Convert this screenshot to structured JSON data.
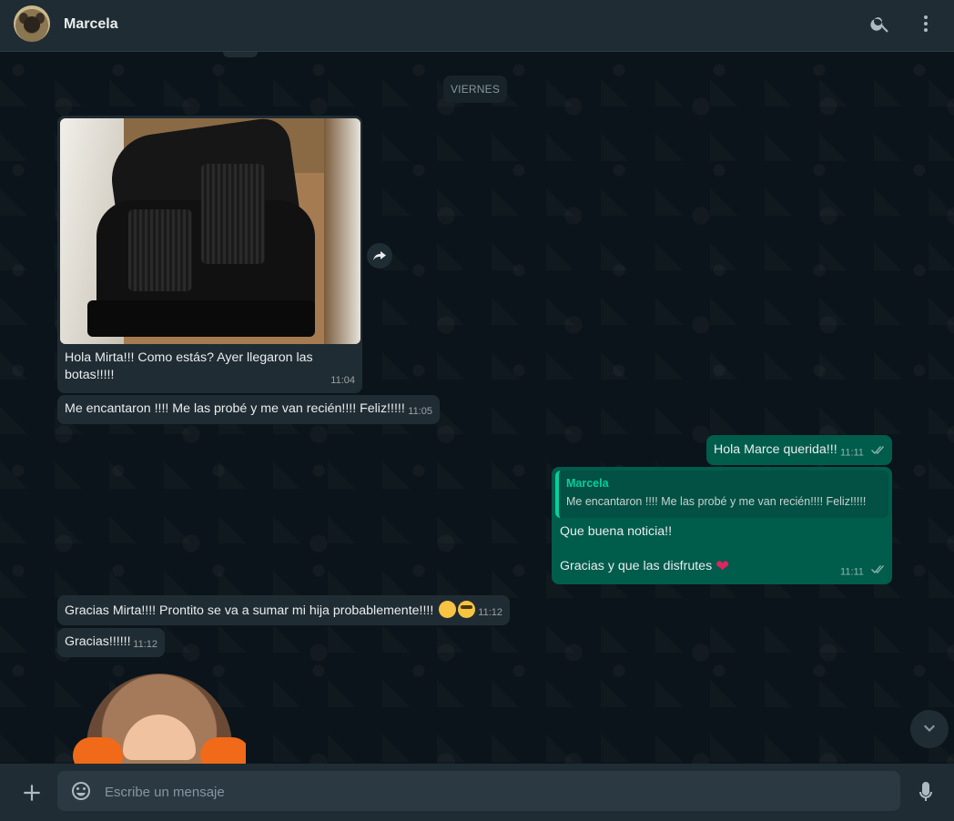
{
  "header": {
    "contact_name": "Marcela",
    "search_icon": "search-icon",
    "menu_icon": "more-vertical-icon"
  },
  "chat": {
    "day_label": "VIERNES",
    "messages": [
      {
        "type": "image",
        "direction": "in",
        "caption": "Hola Mirta!!! Como estás? Ayer llegaron las botas!!!!!",
        "time": "11:04"
      },
      {
        "type": "text",
        "direction": "in",
        "text": "Me encantaron !!!! Me las probé y me van recién!!!! Feliz!!!!!",
        "time": "11:05"
      },
      {
        "type": "text",
        "direction": "out",
        "text": "Hola Marce querida!!!",
        "time": "11:11",
        "status": "read"
      },
      {
        "type": "reply",
        "direction": "out",
        "quote_author": "Marcela",
        "quote_text": "Me encantaron !!!! Me las probé y me van recién!!!! Feliz!!!!!",
        "line1": "Que buena noticia!!",
        "line2": "Gracias y que las disfrutes",
        "time": "11:11",
        "status": "read"
      },
      {
        "type": "text",
        "direction": "in",
        "text": "Gracias Mirta!!!! Prontito se va a sumar mi hija probablemente!!!!",
        "time": "11:12"
      },
      {
        "type": "text",
        "direction": "in",
        "text": "Gracias!!!!!!",
        "time": "11:12"
      }
    ]
  },
  "composer": {
    "placeholder": "Escribe un mensaje"
  },
  "colors": {
    "incoming_bubble": "#202c33",
    "outgoing_bubble": "#005c4b",
    "accent": "#06cf9c",
    "background": "#0b141a"
  }
}
